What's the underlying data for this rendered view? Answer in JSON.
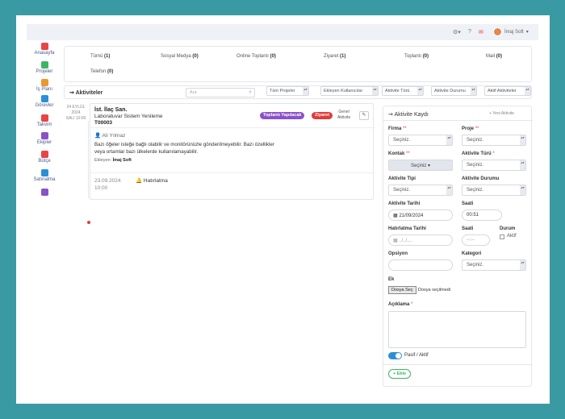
{
  "topbar": {
    "username": "İmaj Soft",
    "icons": [
      "gear-icon",
      "help-icon",
      "notification-icon"
    ]
  },
  "sidebar": {
    "items": [
      {
        "label": "Anasayfa",
        "icon": "home-icon",
        "color": "#e84545"
      },
      {
        "label": "Projeler",
        "icon": "briefcase-icon",
        "color": "#3cb463"
      },
      {
        "label": "İş Planı",
        "icon": "org-chart-icon",
        "color": "#e89a2e"
      },
      {
        "label": "Görevler",
        "icon": "clipboard-icon",
        "color": "#2b8fd8"
      },
      {
        "label": "Takvim",
        "icon": "calendar-icon",
        "color": "#e84545"
      },
      {
        "label": "Ekipler",
        "icon": "team-icon",
        "color": "#8a52c8"
      },
      {
        "label": "Bütçe",
        "icon": "budget-icon",
        "color": "#e84545"
      },
      {
        "label": "Satınalma",
        "icon": "cart-icon",
        "color": "#2b8fd8"
      },
      {
        "label": "",
        "icon": "document-icon",
        "color": "#8a52c8"
      }
    ]
  },
  "categories": [
    {
      "label": "Tümü",
      "count": "(1)"
    },
    {
      "label": "Sosyal Medya",
      "count": "(0)"
    },
    {
      "label": "Online Toplantı",
      "count": "(0)"
    },
    {
      "label": "Ziyaret",
      "count": "(1)"
    },
    {
      "label": "Toplantı",
      "count": "(0)"
    },
    {
      "label": "Mail",
      "count": "(0)"
    },
    {
      "label": "Telefon",
      "count": "(0)"
    }
  ],
  "filterbar": {
    "title": "Aktiviteler",
    "search_placeholder": "Ara",
    "filters": [
      "Tüm Projeler",
      "Ekleyen Kullanıcılar",
      "Aktivite Türü",
      "Aktivite Durumu",
      "Aktif Aktiviteler"
    ]
  },
  "activity": {
    "date_day": "24 EYLÜL",
    "date_year": "2024",
    "date_time": "SALI 10:00",
    "company": "İst. İlaç San.",
    "project": "Laboratuvar Sistem Yenileme",
    "code": "T00003",
    "badge_type": "Toplantı Yapılacak",
    "badge_type_color": "#8a52c8",
    "badge_status": "Ziyaret",
    "badge_status_color": "#e23b3b",
    "general_line1": "Genel",
    "general_line2": "Aktivite",
    "author": "Ali Yılmaz",
    "note": "Bazı öğeler isteğe bağlı olabilir ve monitörünüzle gönderilmeyebilir. Bazı özellikler veya ortamlar bazı ülkelerde kullanılamayabilir.",
    "added_label": "Ekleyen:",
    "added_by": "İmaj Soft",
    "reminder_date": "23.09.2024",
    "reminder_time": "10:00",
    "reminder_label": "Hatırlatma"
  },
  "form": {
    "title": "Aktivite Kaydı",
    "new_button": "+ Yeni Aktivite",
    "fields": {
      "firma": {
        "label": "Firma",
        "value": "Seçiniz."
      },
      "proje": {
        "label": "Proje",
        "value": "Seçiniz."
      },
      "kontak": {
        "label": "Kontak",
        "value": "Seçiniz ▾"
      },
      "aktivite_turu": {
        "label": "Aktivite Türü",
        "value": "Seçiniz."
      },
      "aktivite_tipi": {
        "label": "Aktivite Tipi",
        "value": "Seçiniz."
      },
      "aktivite_durumu": {
        "label": "Aktivite Durumu",
        "value": "Seçiniz."
      },
      "aktivite_tarihi": {
        "label": "Aktivite Tarihi",
        "value": "21/09/2024"
      },
      "saati": {
        "label": "Saati",
        "value": "00:51"
      },
      "hatirlatma_tarihi": {
        "label": "Hatırlatma Tarihi",
        "value": "../../...."
      },
      "saati2": {
        "label": "Saati",
        "value": "--:--"
      },
      "durum": {
        "label": "Durum",
        "value": "Aktif"
      },
      "opsiyon": {
        "label": "Opsiyon",
        "value": ""
      },
      "kategori": {
        "label": "Kategori",
        "value": "Seçiniz."
      },
      "ek": {
        "label": "Ek",
        "button": "Dosya Seç",
        "status": "Dosya seçilmedi"
      },
      "aciklama": {
        "label": "Açıklama"
      }
    },
    "toggle_label": "Pasif / Aktif",
    "add_button": "+ Ekle"
  }
}
